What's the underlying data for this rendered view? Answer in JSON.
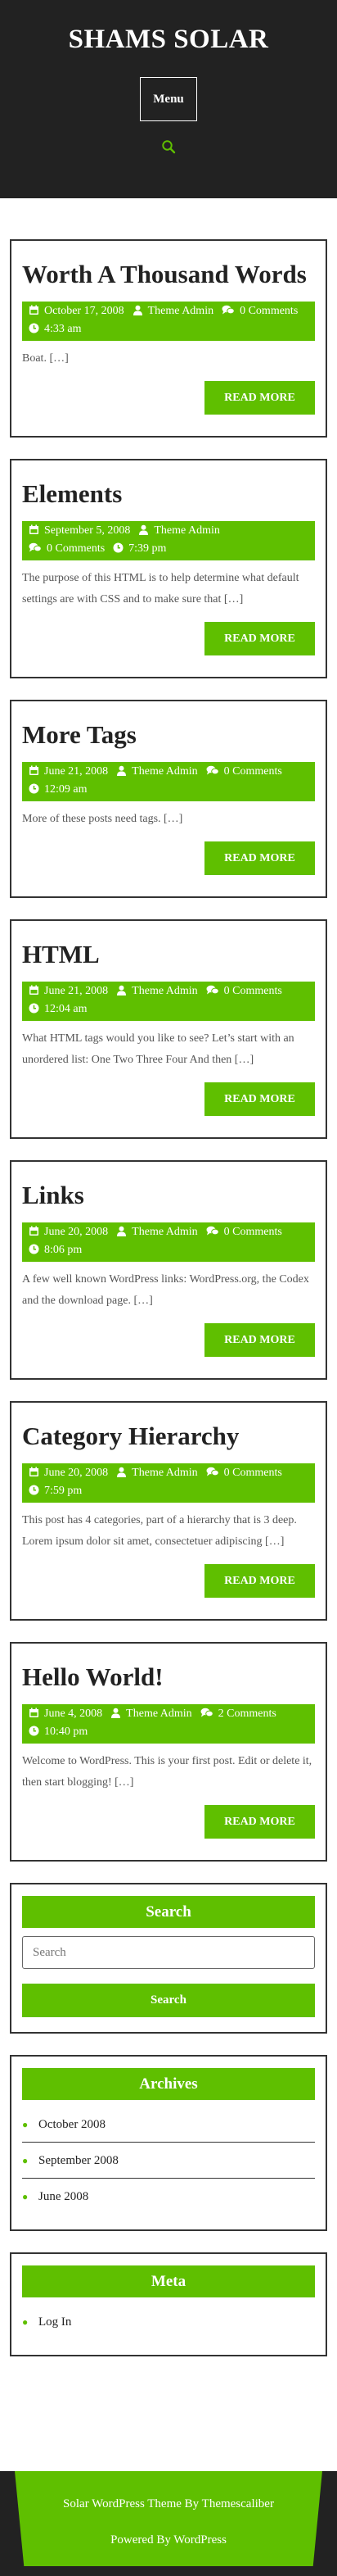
{
  "site": {
    "title": "SHAMS SOLAR",
    "menu_label": "Menu"
  },
  "colors": {
    "accent": "#5fbf00",
    "header_bg": "#222222"
  },
  "posts": [
    {
      "title": "Worth A Thousand Words",
      "date": "October 17, 2008",
      "author": "Theme Admin",
      "comments": "0 Comments",
      "time": "4:33 am",
      "excerpt": "Boat. […]",
      "read_more": "READ MORE"
    },
    {
      "title": "Elements",
      "date": "September 5, 2008",
      "author": "Theme Admin",
      "comments": "0 Comments",
      "time": "7:39 pm",
      "excerpt": "The purpose of this HTML is to help determine what default settings are with CSS and to make sure that […]",
      "read_more": "READ MORE"
    },
    {
      "title": "More Tags",
      "date": "June 21, 2008",
      "author": "Theme Admin",
      "comments": "0 Comments",
      "time": "12:09 am",
      "excerpt": "More of these posts need tags. […]",
      "read_more": "READ MORE"
    },
    {
      "title": "HTML",
      "date": "June 21, 2008",
      "author": "Theme Admin",
      "comments": "0 Comments",
      "time": "12:04 am",
      "excerpt": "What HTML tags would you like to see? Let’s start with an unordered list: One Two Three Four And then […]",
      "read_more": "READ MORE"
    },
    {
      "title": "Links",
      "date": "June 20, 2008",
      "author": "Theme Admin",
      "comments": "0 Comments",
      "time": "8:06 pm",
      "excerpt": "A few well known WordPress links: WordPress.org, the Codex and the download page. […]",
      "read_more": "READ MORE"
    },
    {
      "title": "Category Hierarchy",
      "date": "June 20, 2008",
      "author": "Theme Admin",
      "comments": "0 Comments",
      "time": "7:59 pm",
      "excerpt": "This post has 4 categories, part of a hierarchy that is 3 deep. Lorem ipsum dolor sit amet, consectetuer adipiscing […]",
      "read_more": "READ MORE"
    },
    {
      "title": "Hello World!",
      "date": "June 4, 2008",
      "author": "Theme Admin",
      "comments": "2 Comments",
      "time": "10:40 pm",
      "excerpt": "Welcome to WordPress. This is your first post. Edit or delete it, then start blogging! […]",
      "read_more": "READ MORE"
    }
  ],
  "widgets": {
    "search": {
      "title": "Search",
      "placeholder": "Search",
      "button": "Search"
    },
    "archives": {
      "title": "Archives",
      "items": [
        "October 2008",
        "September 2008",
        "June 2008"
      ]
    },
    "meta": {
      "title": "Meta",
      "items": [
        "Log In"
      ]
    }
  },
  "footer": {
    "line1": "Solar WordPress Theme By Themescaliber",
    "line2": "Powered By WordPress"
  }
}
